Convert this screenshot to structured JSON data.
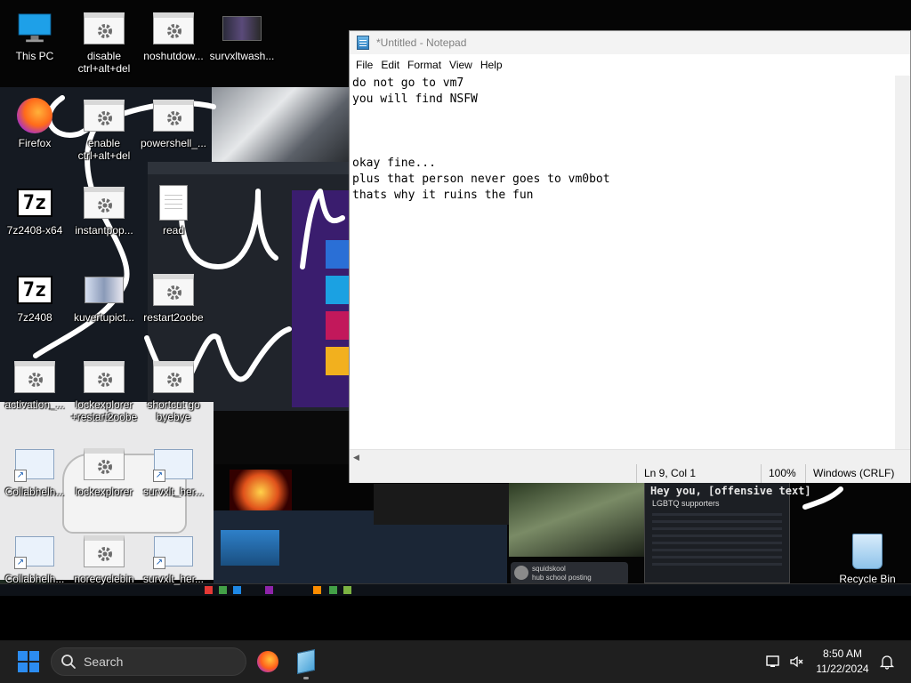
{
  "desktop": {
    "icons": [
      {
        "label": "This PC"
      },
      {
        "label": "disable ctrl+alt+del"
      },
      {
        "label": "noshutdow..."
      },
      {
        "label": "survxltwash..."
      },
      {
        "label": "Firefox"
      },
      {
        "label": "enable ctrl+alt+del"
      },
      {
        "label": "powershell_..."
      },
      {
        "label": "7z2408-x64"
      },
      {
        "label": "instantpop..."
      },
      {
        "label": "read"
      },
      {
        "label": "7z2408"
      },
      {
        "label": "kuvertupict..."
      },
      {
        "label": "restart2oobe"
      },
      {
        "label": "activation_..."
      },
      {
        "label": "lockexplorer +restart2oobe"
      },
      {
        "label": "shortcut go byebye"
      },
      {
        "label": "Collabhelh..."
      },
      {
        "label": "lockexplorer"
      },
      {
        "label": "survxlt_her..."
      },
      {
        "label": "Collabhelh..."
      },
      {
        "label": "norecyclebin"
      },
      {
        "label": "survxlt_her..."
      },
      {
        "label": "Recycle Bin"
      }
    ]
  },
  "wallpaper": {
    "scribble_text": "Sur We",
    "terminal_heading": "Hey you, [offensive text]",
    "terminal_sub": "LGBTQ supporters",
    "chat_user": "squidskool",
    "chat_text": "hub school posting"
  },
  "notepad": {
    "title": "*Untitled - Notepad",
    "menu": [
      "File",
      "Edit",
      "Format",
      "View",
      "Help"
    ],
    "content": "do not go to vm7\nyou will find NSFW\n\n\n\nokay fine...\nplus that person never goes to vm0bot\nthats why it ruins the fun",
    "status": {
      "position": "Ln 9, Col 1",
      "zoom": "100%",
      "line_ending": "Windows (CRLF)"
    }
  },
  "taskbar": {
    "search_placeholder": "Search",
    "apps": [
      "firefox-icon",
      "notepad-icon"
    ],
    "time": "8:50 AM",
    "date": "11/22/2024"
  },
  "colors": {
    "accent": "#2c8cf0",
    "taskbar_bg": "#1f1f1f",
    "notepad_bg": "#ffffff"
  }
}
